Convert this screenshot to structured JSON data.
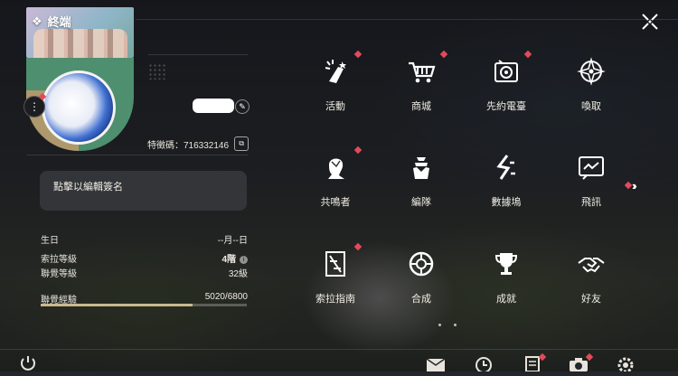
{
  "header": {
    "title": "終端"
  },
  "profile": {
    "id_label": "特徵碼：",
    "id_value": "716332146",
    "signature_placeholder": "點擊以編輯簽名"
  },
  "stats": [
    {
      "label": "生日",
      "value": "--月--日"
    },
    {
      "label": "索拉等級",
      "value": "4階"
    },
    {
      "label": "聯覺等級",
      "value": "32級"
    }
  ],
  "experience": {
    "label": "聯覺經驗",
    "value": "5020/6800",
    "current": 5020,
    "max": 6800
  },
  "menu": [
    {
      "label": "活動",
      "icon": "activity-icon",
      "badge": true
    },
    {
      "label": "商城",
      "icon": "shop-cart-icon",
      "badge": true
    },
    {
      "label": "先約電臺",
      "icon": "radio-icon",
      "badge": true
    },
    {
      "label": "喚取",
      "icon": "summon-icon",
      "badge": false
    },
    {
      "label": "共鳴者",
      "icon": "resonator-icon",
      "badge": true
    },
    {
      "label": "編隊",
      "icon": "team-icon",
      "badge": false
    },
    {
      "label": "數據塢",
      "icon": "data-dock-icon",
      "badge": false
    },
    {
      "label": "飛訊",
      "icon": "message-icon",
      "badge": false
    },
    {
      "label": "索拉指南",
      "icon": "guidebook-icon",
      "badge": true
    },
    {
      "label": "合成",
      "icon": "synthesis-icon",
      "badge": false
    },
    {
      "label": "成就",
      "icon": "achievement-icon",
      "badge": false
    },
    {
      "label": "好友",
      "icon": "friends-icon",
      "badge": false
    }
  ],
  "colors": {
    "badge": "#e24a5a",
    "accent": "#c9b98e"
  }
}
